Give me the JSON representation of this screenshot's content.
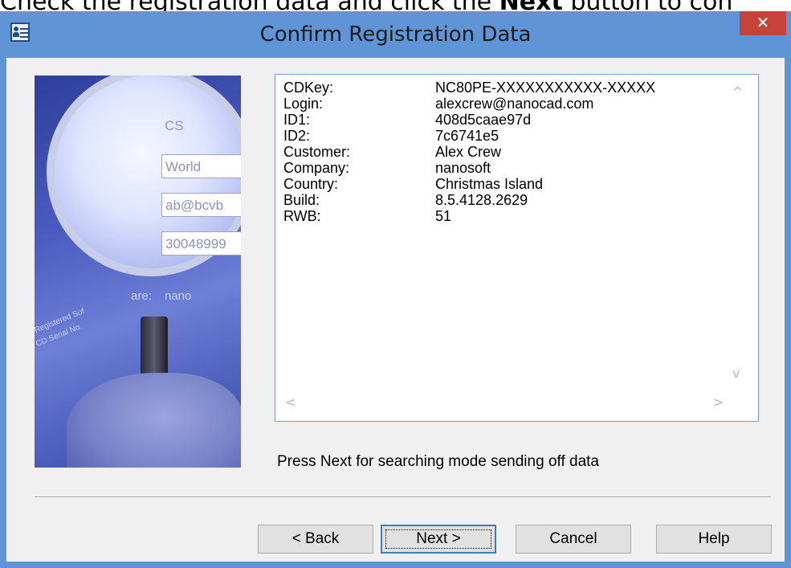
{
  "caption": {
    "prefix": "Check the registration data and click the ",
    "bold": "Next",
    "suffix": " button to con"
  },
  "window": {
    "title": "Confirm Registration Data",
    "close_label": "✕"
  },
  "illustration": {
    "fields": [
      "CS",
      "World",
      "ab@bcvb",
      "30048999"
    ],
    "labels": [
      "are:",
      "nano",
      "Registered Sof",
      "CD Serial No."
    ]
  },
  "registration_data": {
    "rows": [
      {
        "key": "CDKey:",
        "value": "NC80PE-XXXXXXXXXXX-XXXXX"
      },
      {
        "key": "Login:",
        "value": "alexcrew@nanocad.com"
      },
      {
        "key": "ID1:",
        "value": "408d5caae97d"
      },
      {
        "key": "ID2:",
        "value": "7c6741e5"
      },
      {
        "key": "Customer:",
        "value": "Alex Crew"
      },
      {
        "key": "Company:",
        "value": "nanosoft"
      },
      {
        "key": "Country:",
        "value": "Christmas Island"
      },
      {
        "key": "Build:",
        "value": "8.5.4128.2629"
      },
      {
        "key": "RWB:",
        "value": "51"
      }
    ],
    "scroll_up": "^",
    "scroll_down": "v",
    "scroll_left": "<",
    "scroll_right": ">"
  },
  "hint": "Press Next for searching mode sending off data",
  "buttons": {
    "back": "< Back",
    "next": "Next >",
    "cancel": "Cancel",
    "help": "Help"
  },
  "colors": {
    "titlebar": "#5f95d6",
    "close": "#c7423a",
    "data_border": "#7a9cd3"
  }
}
